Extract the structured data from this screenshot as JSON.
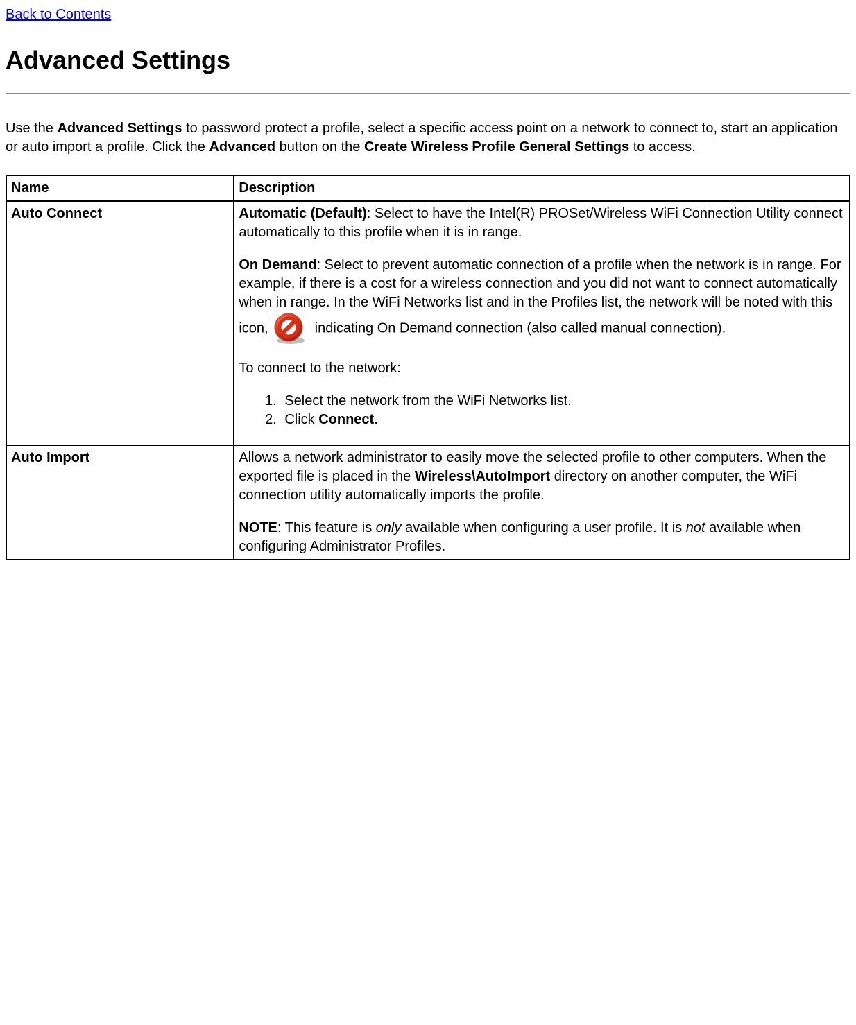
{
  "back_link": "Back to Contents",
  "page_title": "Advanced Settings",
  "intro": {
    "part1": "Use the ",
    "bold1": "Advanced Settings",
    "part2": " to password protect a profile, select a specific access point on a network to connect to, start an application or auto import a profile. Click the ",
    "bold2": "Advanced",
    "part3": " button on the ",
    "bold3": "Create Wireless Profile General Settings",
    "part4": " to access."
  },
  "table": {
    "headers": {
      "name": "Name",
      "description": "Description"
    },
    "rows": {
      "auto_connect": {
        "name": "Auto Connect",
        "desc": {
          "automatic_bold": "Automatic (Default)",
          "automatic_rest": ": Select to have the Intel(R) PROSet/Wireless WiFi Connection Utility connect automatically to this profile when it is in range.",
          "on_demand_bold": "On Demand",
          "on_demand_rest1": ": Select to prevent automatic connection of a profile when the network is in range. For example, if there is a cost for a wireless connection and you did not want to connect automatically when in range. In the WiFi Networks list and in the Profiles list, the network will be noted with this icon, ",
          "on_demand_rest2": " indicating On Demand connection (also called manual connection).",
          "to_connect": "To connect to the network:",
          "step1": "Select the network from the WiFi Networks list.",
          "step2_pre": "Click ",
          "step2_bold": "Connect",
          "step2_post": "."
        }
      },
      "auto_import": {
        "name": "Auto Import",
        "desc": {
          "part1": "Allows a network administrator to easily move the selected profile to other computers. When the exported file is placed in the ",
          "bold1": "Wireless\\AutoImport",
          "part2": " directory on another computer, the WiFi connection utility automatically imports the profile.",
          "note_bold": "NOTE",
          "note_part1": ": This feature is ",
          "note_italic1": "only",
          "note_part2": " available when configuring a user profile. It is ",
          "note_italic2": "not",
          "note_part3": " available when configuring Administrator Profiles."
        }
      }
    }
  }
}
